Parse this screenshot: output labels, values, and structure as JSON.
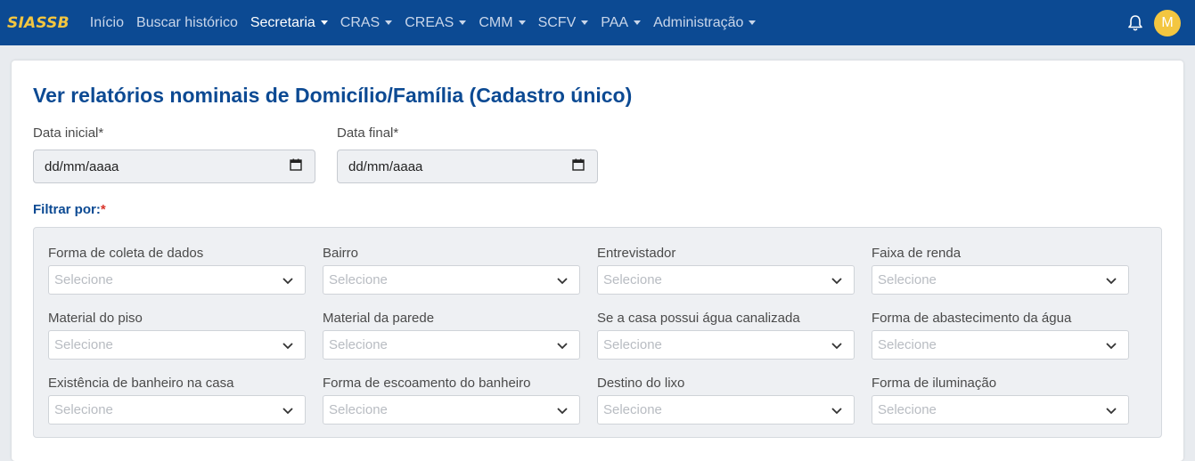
{
  "navbar": {
    "brand": "SIASSB",
    "items": [
      {
        "label": "Início",
        "dropdown": false,
        "active": false
      },
      {
        "label": "Buscar histórico",
        "dropdown": false,
        "active": false
      },
      {
        "label": "Secretaria",
        "dropdown": true,
        "active": true
      },
      {
        "label": "CRAS",
        "dropdown": true,
        "active": false
      },
      {
        "label": "CREAS",
        "dropdown": true,
        "active": false
      },
      {
        "label": "CMM",
        "dropdown": true,
        "active": false
      },
      {
        "label": "SCFV",
        "dropdown": true,
        "active": false
      },
      {
        "label": "PAA",
        "dropdown": true,
        "active": false
      },
      {
        "label": "Administração",
        "dropdown": true,
        "active": false
      }
    ],
    "notification_icon": "bell-icon",
    "avatar_initial": "M"
  },
  "page": {
    "title": "Ver relatórios nominais de Domicílio/Família (Cadastro único)",
    "date_start": {
      "label": "Data inicial*",
      "placeholder": "dd/mm/aaaa",
      "icon": "calendar-icon"
    },
    "date_end": {
      "label": "Data final*",
      "placeholder": "dd/mm/aaaa",
      "icon": "calendar-icon"
    },
    "filter_title": "Filtrar por:",
    "filter_required_mark": "*",
    "filters": [
      {
        "label": "Forma de coleta de dados",
        "placeholder": "Selecione"
      },
      {
        "label": "Bairro",
        "placeholder": "Selecione"
      },
      {
        "label": "Entrevistador",
        "placeholder": "Selecione"
      },
      {
        "label": "Faixa de renda",
        "placeholder": "Selecione"
      },
      {
        "label": "Material do piso",
        "placeholder": "Selecione"
      },
      {
        "label": "Material da parede",
        "placeholder": "Selecione"
      },
      {
        "label": "Se a casa possui água canalizada",
        "placeholder": "Selecione"
      },
      {
        "label": "Forma de abastecimento da água",
        "placeholder": "Selecione"
      },
      {
        "label": "Existência de banheiro na casa",
        "placeholder": "Selecione"
      },
      {
        "label": "Forma de escoamento do banheiro",
        "placeholder": "Selecione"
      },
      {
        "label": "Destino do lixo",
        "placeholder": "Selecione"
      },
      {
        "label": "Forma de iluminação",
        "placeholder": "Selecione"
      }
    ]
  },
  "colors": {
    "navbar_bg": "#0c4a93",
    "brand": "#f3c640",
    "title": "#0c4a93",
    "required": "#d9342b"
  }
}
